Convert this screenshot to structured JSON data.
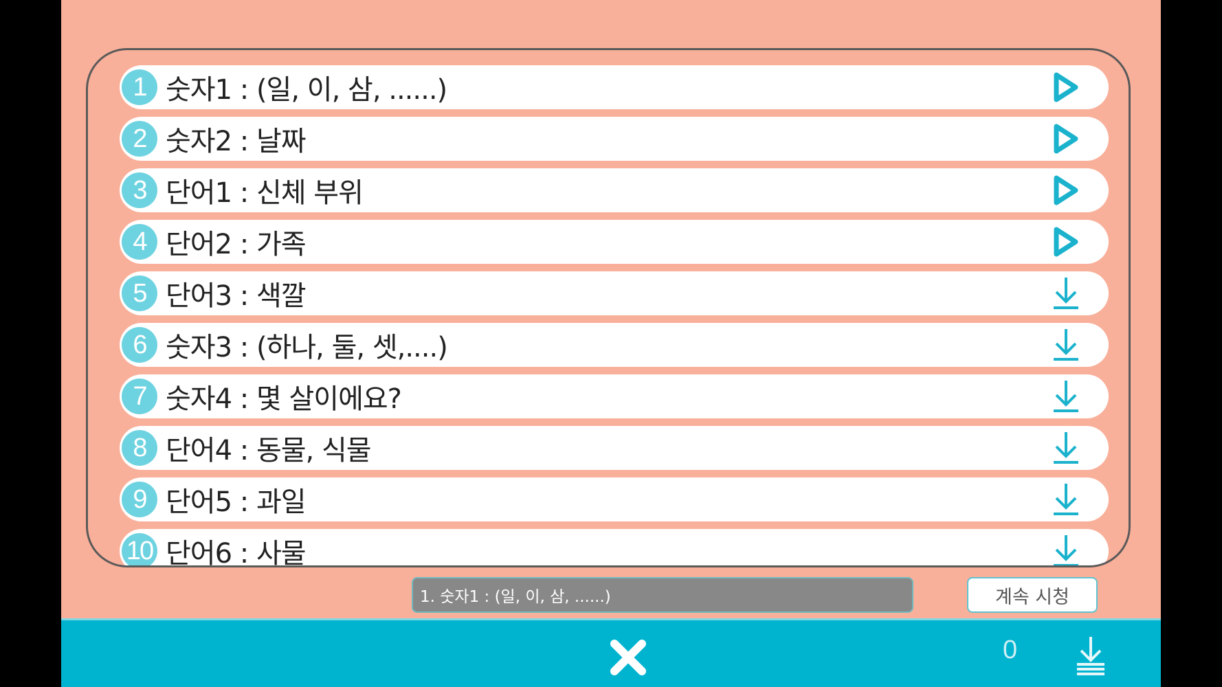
{
  "colors": {
    "background": "#f9b09a",
    "accent": "#00b4d0",
    "badge": "#6ed3e0",
    "icon": "#1ab2cc"
  },
  "lessons": [
    {
      "number": "1",
      "label": "숫자1 : (일, 이, 삼, ......)",
      "action": "play-icon"
    },
    {
      "number": "2",
      "label": "숫자2 : 날짜",
      "action": "play-icon"
    },
    {
      "number": "3",
      "label": "단어1 : 신체 부위",
      "action": "play-icon"
    },
    {
      "number": "4",
      "label": "단어2 : 가족",
      "action": "play-icon"
    },
    {
      "number": "5",
      "label": "단어3 : 색깔",
      "action": "download-icon"
    },
    {
      "number": "6",
      "label": "숫자3 : (하나, 둘, 셋,....)",
      "action": "download-icon"
    },
    {
      "number": "7",
      "label": "숫자4 : 몇 살이에요?",
      "action": "download-icon"
    },
    {
      "number": "8",
      "label": "단어4 : 동물, 식물",
      "action": "download-icon"
    },
    {
      "number": "9",
      "label": "단어5 : 과일",
      "action": "download-icon"
    },
    {
      "number": "10",
      "label": "단어6 : 사물",
      "action": "download-icon"
    }
  ],
  "player": {
    "now_playing": "1. 숫자1 : (일, 이, 삼, ......)",
    "continue_label": "계속 시청"
  },
  "footer": {
    "close_icon": "close-x-icon",
    "download_count": "0",
    "download_all_icon": "download-all-icon"
  }
}
